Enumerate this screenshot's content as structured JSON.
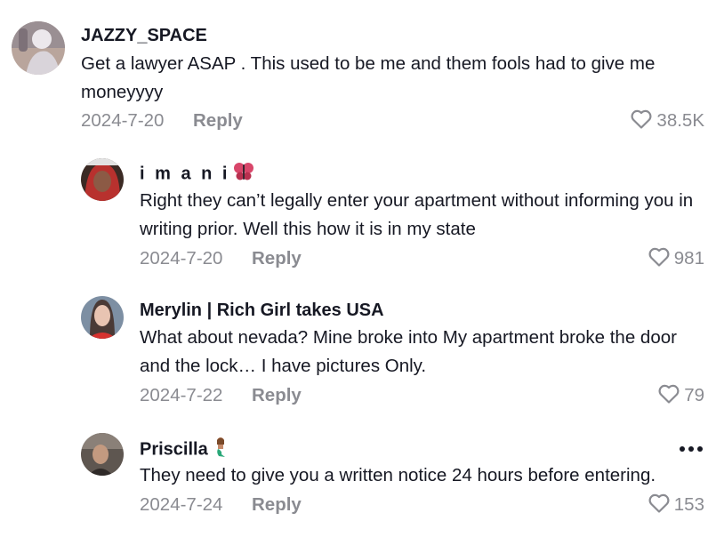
{
  "comments": [
    {
      "username": "JAZZY_SPACE",
      "text": "Get a lawyer ASAP . This used to be me and them fools had to give me moneyyyy",
      "date": "2024-7-20",
      "reply_label": "Reply",
      "likes": "38.5K"
    },
    {
      "username": "i m a n i",
      "emoji": "butterfly-emoji",
      "text": "Right they can’t legally enter your apartment without informing you in writing prior. Well this how it is in my state",
      "date": "2024-7-20",
      "reply_label": "Reply",
      "likes": "981"
    },
    {
      "username": "Merylin | Rich Girl takes USA",
      "text": "What about nevada? Mine broke into My apartment broke the door and the lock… I have pictures Only.",
      "date": "2024-7-22",
      "reply_label": "Reply",
      "likes": "79"
    },
    {
      "username": "Priscilla",
      "emoji": "mermaid-emoji",
      "text": "They need to give you a written notice 24 hours before entering.",
      "date": "2024-7-24",
      "reply_label": "Reply",
      "likes": "153"
    }
  ],
  "icons": {
    "like": "heart-outline-icon",
    "more": "more-horizontal-icon"
  },
  "colors": {
    "text_primary": "#161823",
    "text_secondary": "#8a8b91"
  }
}
